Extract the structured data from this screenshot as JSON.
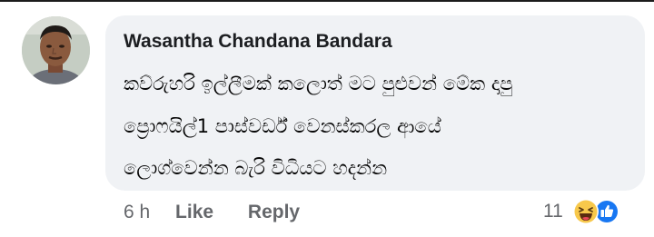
{
  "comment": {
    "author_name": "Wasantha Chandana Bandara",
    "text_lines": [
      "කව්රුහරි ඉල්ලීමක් කලොත් මට පුළුවන් මේක දාපු",
      "ප්‍රොෆයිල්1 පාස්වර්ඩ් වෙනස්කරල ආයේ",
      "ලොග්වෙන්න බැරි විධියට හදන්න"
    ]
  },
  "actions": {
    "time": "6 h",
    "like_label": "Like",
    "reply_label": "Reply"
  },
  "reactions": {
    "count": "11",
    "icons": [
      "haha-reaction-icon",
      "like-reaction-icon"
    ]
  },
  "colors": {
    "bubble": "#f0f2f5",
    "meta_text": "#65676b",
    "like_blue": "#1877f2",
    "haha_yellow": "#f7c84b"
  }
}
